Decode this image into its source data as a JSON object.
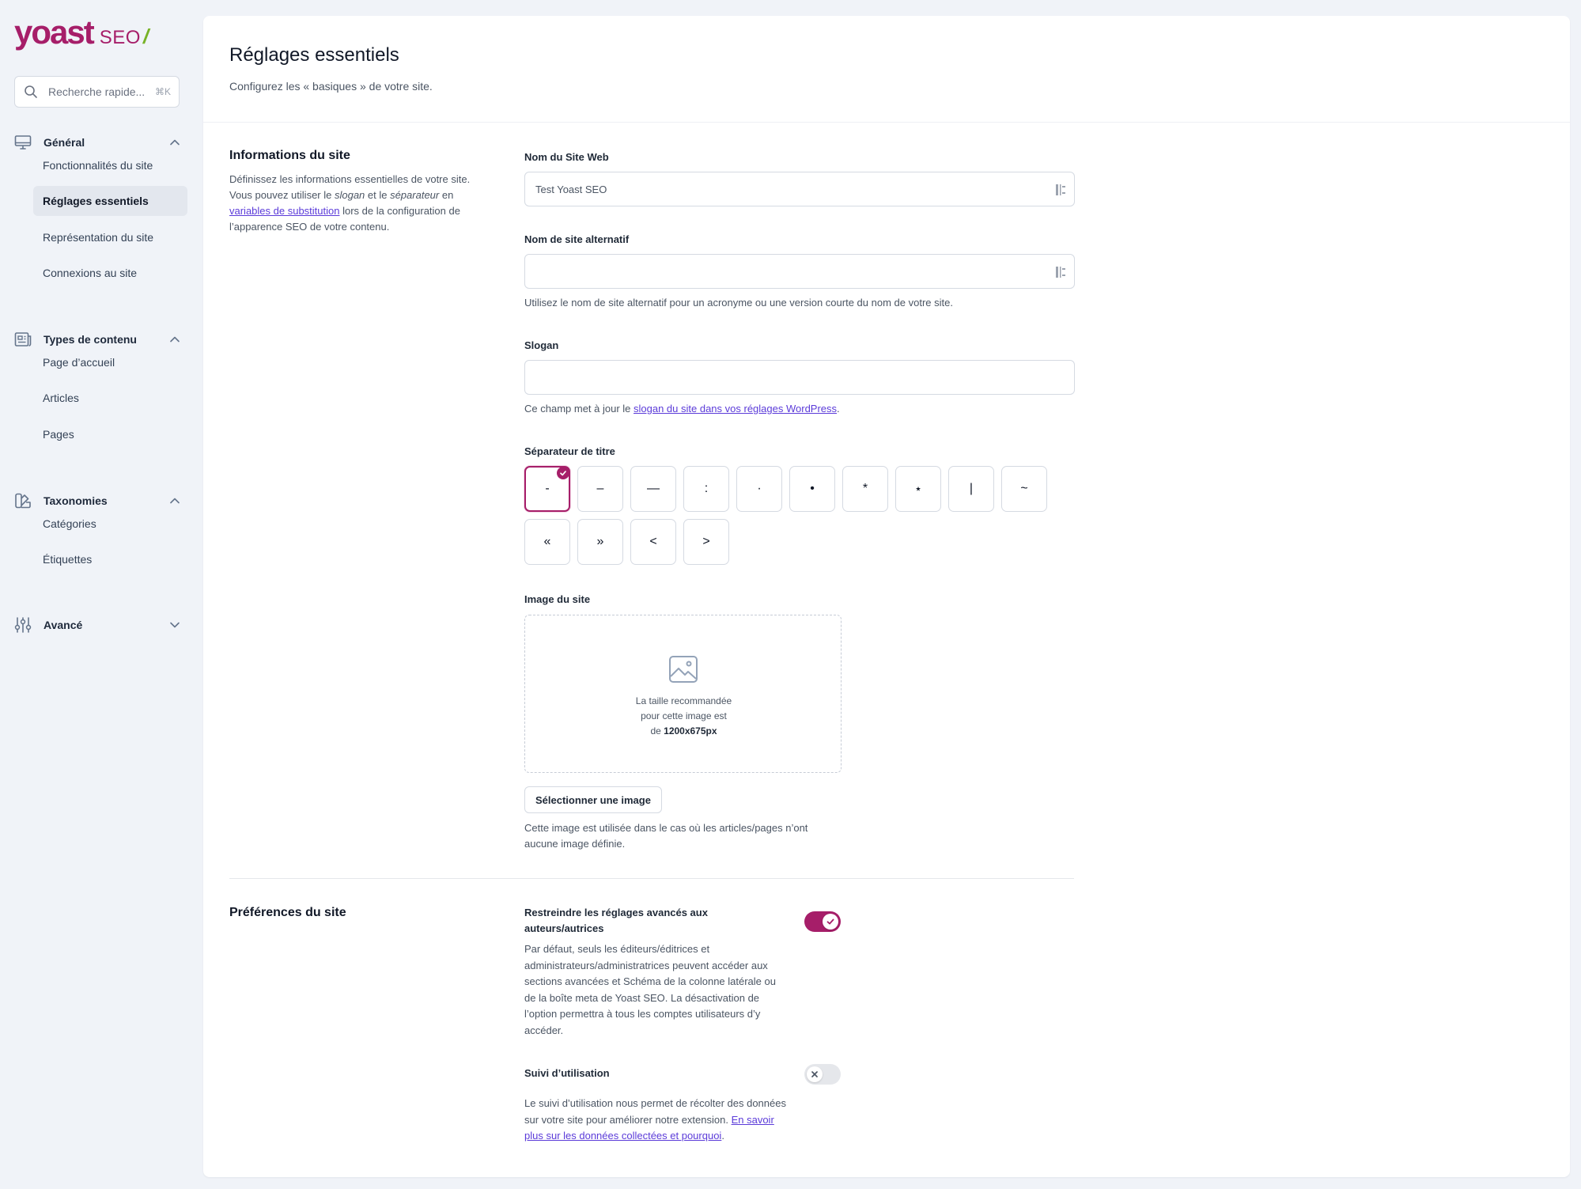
{
  "logo": {
    "main": "yoast",
    "seo": "SEO",
    "slash": "/"
  },
  "search": {
    "placeholder": "Recherche rapide...",
    "shortcut": "⌘K"
  },
  "sidebar": {
    "groups": [
      {
        "label": "Général",
        "icon": "desktop-icon",
        "expanded": true,
        "items": [
          {
            "label": "Fonctionnalités du site",
            "active": false
          },
          {
            "label": "Réglages essentiels",
            "active": true
          },
          {
            "label": "Représentation du site",
            "active": false
          },
          {
            "label": "Connexions au site",
            "active": false
          }
        ]
      },
      {
        "label": "Types de contenu",
        "icon": "newspaper-icon",
        "expanded": true,
        "items": [
          {
            "label": "Page d’accueil",
            "active": false
          },
          {
            "label": "Articles",
            "active": false
          },
          {
            "label": "Pages",
            "active": false
          }
        ]
      },
      {
        "label": "Taxonomies",
        "icon": "color-swatch-icon",
        "expanded": true,
        "items": [
          {
            "label": "Catégories",
            "active": false
          },
          {
            "label": "Étiquettes",
            "active": false
          }
        ]
      },
      {
        "label": "Avancé",
        "icon": "adjustments-icon",
        "expanded": false,
        "items": []
      }
    ]
  },
  "page": {
    "title": "Réglages essentiels",
    "subtitle": "Configurez les « basiques » de votre site."
  },
  "site_info": {
    "title": "Informations du site",
    "desc_1": "Définissez les informations essentielles de votre site. Vous pouvez utiliser le ",
    "desc_slogan": "slogan",
    "desc_2": " et le ",
    "desc_separator": "séparateur",
    "desc_3": " en ",
    "desc_link": "variables de substitution",
    "desc_4": " lors de la configuration de l’apparence SEO de votre contenu.",
    "site_name": {
      "label": "Nom du Site Web",
      "value": "Test Yoast SEO"
    },
    "alt_name": {
      "label": "Nom de site alternatif",
      "value": "",
      "help": "Utilisez le nom de site alternatif pour un acronyme ou une version courte du nom de votre site."
    },
    "tagline": {
      "label": "Slogan",
      "value": "",
      "help_before": "Ce champ met à jour le ",
      "help_link": "slogan du site dans vos réglages WordPress",
      "help_after": "."
    },
    "separator": {
      "label": "Séparateur de titre",
      "options": [
        "-",
        "–",
        "—",
        ":",
        "·",
        "•",
        "*",
        "⋆",
        "|",
        "~",
        "«",
        "»",
        "<",
        ">"
      ],
      "selected_index": 0
    },
    "site_image": {
      "label": "Image du site",
      "hint_1": "La taille recommandée",
      "hint_2": "pour cette image est",
      "hint_3": "de",
      "hint_size": "1200x675px",
      "button": "Sélectionner une image",
      "help": "Cette image est utilisée dans le cas où les articles/pages n’ont aucune image définie."
    }
  },
  "preferences": {
    "title": "Préférences du site",
    "restrict": {
      "label": "Restreindre les réglages avancés aux auteurs/autrices",
      "desc": "Par défaut, seuls les éditeurs/éditrices et administrateurs/administratrices peuvent accéder aux sections avancées et Schéma de la colonne latérale ou de la boîte meta de Yoast SEO. La désactivation de l’option permettra à tous les comptes utilisateurs d’y accéder.",
      "enabled": true
    },
    "tracking": {
      "label": "Suivi d’utilisation",
      "desc": "Le suivi d’utilisation nous permet de récolter des données sur votre site pour améliorer notre extension. ",
      "link": "En savoir plus sur les données collectées et pourquoi",
      "after": ".",
      "enabled": false
    }
  },
  "colors": {
    "brand": "#a61e69",
    "accent_green": "#77b227",
    "link": "#5b3bd9"
  }
}
